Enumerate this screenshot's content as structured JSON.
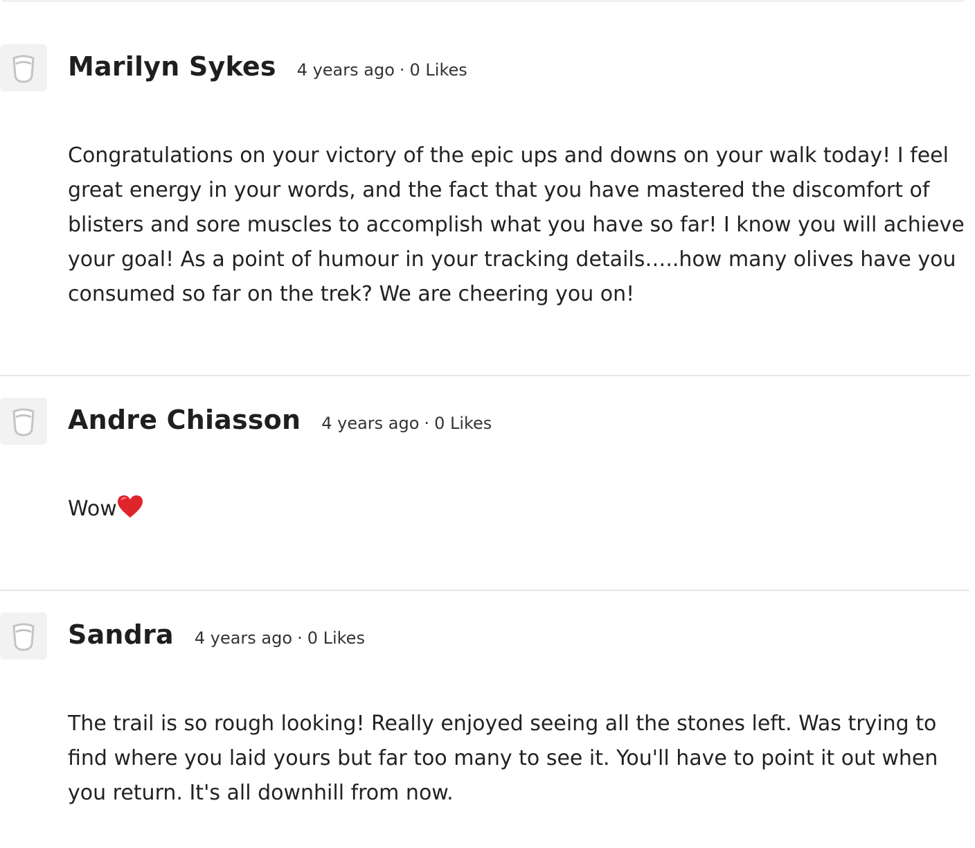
{
  "comments": [
    {
      "author": "Marilyn Sykes",
      "time": "4 years ago",
      "likes": "0 Likes",
      "body": "Congratulations on your victory of the epic ups and downs on your walk today! I feel great energy in your words, and the fact that you have mastered the discomfort of blisters and sore muscles to accomplish what you have so far! I know you will achieve your goal! As a point of humour in your tracking details…..how many olives have you consumed so far on the trek? We are cheering you on!"
    },
    {
      "author": "Andre Chiasson",
      "time": "4 years ago",
      "likes": "0 Likes",
      "body": "Wow",
      "emoji": "heart-emoji"
    },
    {
      "author": "Sandra",
      "time": "4 years ago",
      "likes": "0 Likes",
      "body": "The trail is so rough looking! Really enjoyed seeing all the stones left. Was trying to find where you laid yours but far too many to see it. You'll have to point it out when you return. It's all downhill from now."
    }
  ],
  "icons": {
    "avatar": "default-avatar-icon",
    "reaction": "heart-icon"
  },
  "colors": {
    "divider": "#e6e6e6",
    "avatar_bg": "#f2f2f2",
    "heart": "#e0242b"
  }
}
